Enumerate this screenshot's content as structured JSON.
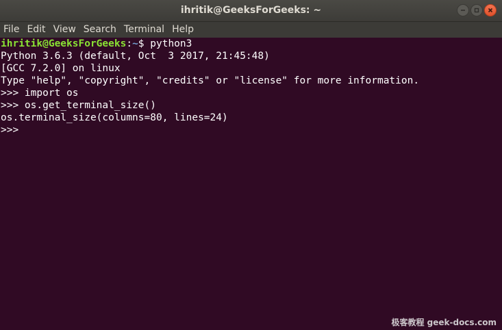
{
  "window": {
    "title": "ihritik@GeeksForGeeks: ~"
  },
  "menu": {
    "items": [
      "File",
      "Edit",
      "View",
      "Search",
      "Terminal",
      "Help"
    ]
  },
  "terminal": {
    "prompt_user": "ihritik@GeeksForGeeks",
    "prompt_sep": ":",
    "prompt_path": "~",
    "prompt_suffix": "$ ",
    "command": "python3",
    "lines": [
      "Python 3.6.3 (default, Oct  3 2017, 21:45:48)",
      "[GCC 7.2.0] on linux",
      "Type \"help\", \"copyright\", \"credits\" or \"license\" for more information.",
      ">>> import os",
      ">>> os.get_terminal_size()",
      "os.terminal_size(columns=80, lines=24)",
      ">>> "
    ]
  },
  "watermark": "极客教程 geek-docs.com",
  "colors": {
    "terminal_bg": "#300a24",
    "titlebar_bg": "#3d3c38",
    "prompt_user": "#8ae234",
    "prompt_path": "#729fcf",
    "close_button": "#e9582f"
  },
  "icons": [
    "minimize-icon",
    "maximize-icon",
    "close-icon"
  ]
}
